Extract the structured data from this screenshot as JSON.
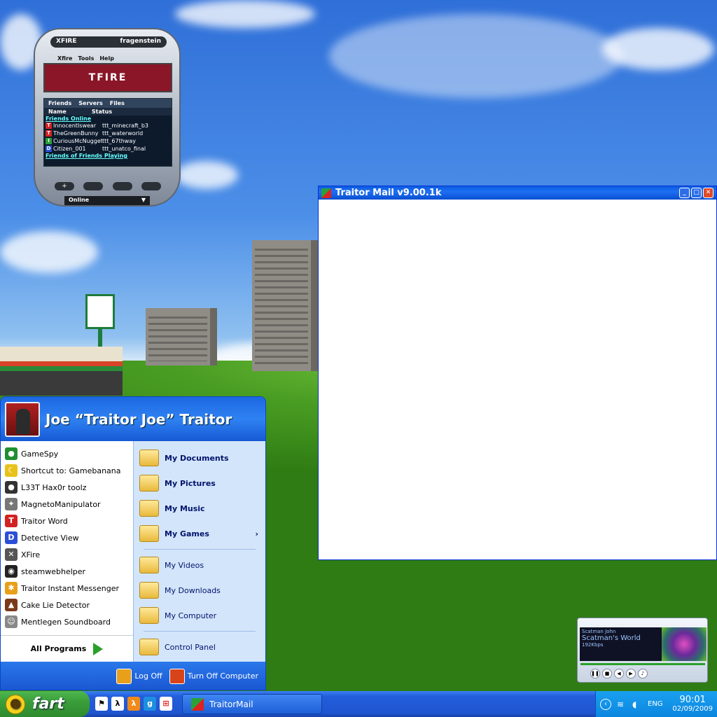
{
  "xfire": {
    "logo": "XFIRE",
    "username": "fragenstein",
    "menu": [
      "Xfire",
      "Tools",
      "Help"
    ],
    "banner": "TFIRE",
    "tabs": [
      "Friends",
      "Servers",
      "Files"
    ],
    "columns": [
      "Name",
      "Status"
    ],
    "group_online": "Friends Online",
    "friends": [
      {
        "icon_letter": "T",
        "icon_color": "#d22222",
        "name": "InnocentIswear",
        "status": "ttt_minecraft_b3"
      },
      {
        "icon_letter": "T",
        "icon_color": "#d22222",
        "name": "TheGreenBunny",
        "status": "ttt_waterworld"
      },
      {
        "icon_letter": "I",
        "icon_color": "#2a9f3b",
        "name": "CuriousMcNugget",
        "status": "ttt_67thway"
      },
      {
        "icon_letter": "D",
        "icon_color": "#2b4fd6",
        "name": "Citizen_001",
        "status": "ttt_unatco_final"
      }
    ],
    "group_fof": "Friends of Friends Playing",
    "buttons": [
      "+",
      "",
      "",
      ""
    ],
    "status_select": "Online"
  },
  "mail": {
    "title": "Traitor Mail v9.00.1k",
    "controls": [
      "_",
      "□",
      "✕"
    ]
  },
  "start_menu": {
    "user_name": "Joe “Traitor Joe” Traitor",
    "left_items": [
      {
        "label": "GameSpy",
        "icon": "gamespy-icon",
        "color": "#1f8f2f",
        "glyph": "●"
      },
      {
        "label": "Shortcut to: Gamebanana",
        "icon": "banana-icon",
        "color": "#e8c21a",
        "glyph": "☾"
      },
      {
        "label": "L33T Hax0r toolz",
        "icon": "bombs-icon",
        "color": "#333333",
        "glyph": "●"
      },
      {
        "label": "MagnetoManipulator",
        "icon": "magneto-icon",
        "color": "#777777",
        "glyph": "✦"
      },
      {
        "label": "Traitor Word",
        "icon": "traitor-word-icon",
        "color": "#d22222",
        "glyph": "T"
      },
      {
        "label": "Detective View",
        "icon": "detective-icon",
        "color": "#2b4fd6",
        "glyph": "D"
      },
      {
        "label": "XFire",
        "icon": "xfire-icon",
        "color": "#555555",
        "glyph": "✕"
      },
      {
        "label": "steamwebhelper",
        "icon": "steam-icon",
        "color": "#222222",
        "glyph": "◉"
      },
      {
        "label": "Traitor Instant Messenger",
        "icon": "messenger-icon",
        "color": "#e8a01a",
        "glyph": "✱"
      },
      {
        "label": "Cake Lie Detector",
        "icon": "cake-icon",
        "color": "#7a3a1a",
        "glyph": "▲"
      },
      {
        "label": "Mentlegen Soundboard",
        "icon": "soundboard-icon",
        "color": "#888888",
        "glyph": "☺"
      }
    ],
    "all_programs": "All Programs",
    "right_items": [
      {
        "label": "My Documents",
        "bold": true,
        "icon": "folder-documents-icon"
      },
      {
        "label": "My Pictures",
        "bold": true,
        "icon": "folder-pictures-icon"
      },
      {
        "label": "My Music",
        "bold": true,
        "icon": "folder-music-icon"
      },
      {
        "label": "My Games",
        "bold": true,
        "icon": "folder-games-icon",
        "arrow": "›"
      },
      {
        "label": "My Videos",
        "bold": false,
        "icon": "folder-videos-icon"
      },
      {
        "label": "My Downloads",
        "bold": false,
        "icon": "folder-downloads-icon"
      },
      {
        "label": "My Computer",
        "bold": false,
        "icon": "computer-icon"
      },
      {
        "label": "Control Panel",
        "bold": false,
        "icon": "control-panel-icon"
      }
    ],
    "log_off": "Log Off",
    "turn_off": "Turn Off Computer"
  },
  "wmp": {
    "artist": "Scatman John",
    "title": "Scatman's World",
    "bitrate": "192Kbps"
  },
  "taskbar": {
    "start_label": "fart",
    "quick_launch": [
      {
        "icon": "runner-icon",
        "glyph": "Ἴ3"
      },
      {
        "icon": "halflife-icon",
        "glyph": "λ"
      },
      {
        "icon": "halflife-icon",
        "glyph": "λ"
      },
      {
        "icon": "gmod-icon",
        "glyph": "g"
      },
      {
        "icon": "windows-icon",
        "glyph": "⊞"
      }
    ],
    "task_button": "TraitorMail",
    "tray_lang": "ENG",
    "time": "90:01",
    "date": "02/09/2009"
  },
  "colors": {
    "taskbar_blue": "#245edb",
    "start_green": "#3a9e3a",
    "xfire_banner": "#8a1628"
  }
}
